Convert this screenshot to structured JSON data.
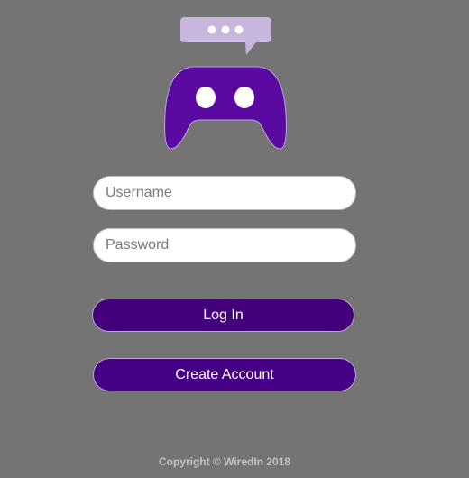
{
  "colors": {
    "page_background": "#747474",
    "brand": "#5a0aa0",
    "button": "#43007b",
    "bubble": "#c7b7dc"
  },
  "logo": {
    "controller_icon": "gamepad-icon",
    "bubble_icon": "chat-bubble-icon"
  },
  "form": {
    "username_placeholder": "Username",
    "password_placeholder": "Password",
    "login_label": "Log In",
    "create_account_label": "Create Account"
  },
  "footer": {
    "copyright": "Copyright © WiredIn 2018"
  }
}
